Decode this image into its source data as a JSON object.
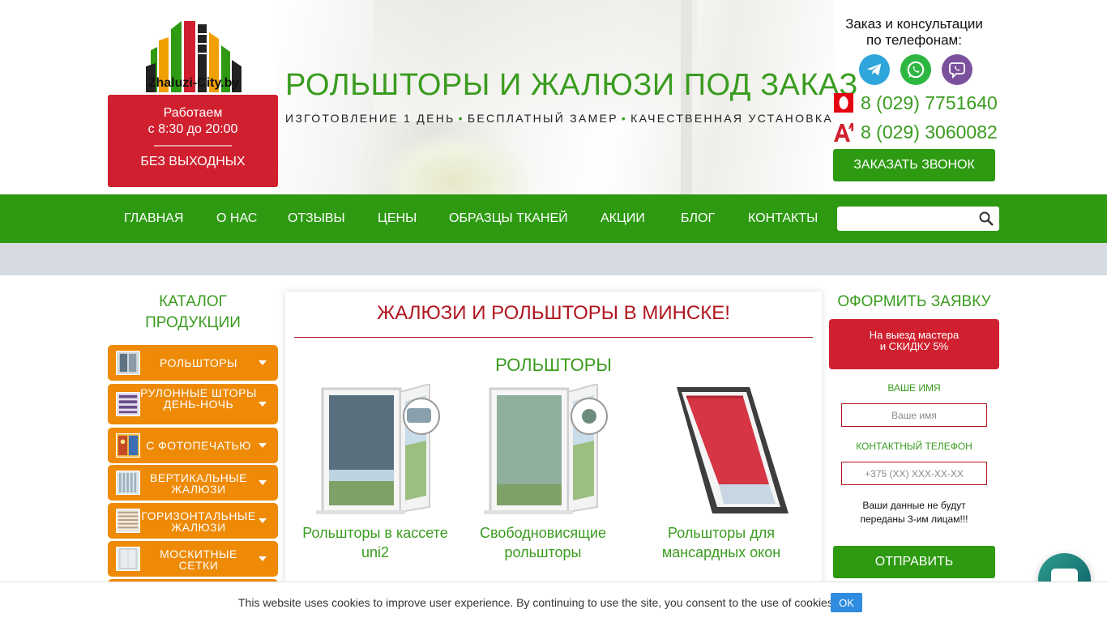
{
  "header": {
    "logo_text": "Zhaluzi-City.by",
    "hours": {
      "line1": "Работаем",
      "line2": "с 8:30 до 20:00",
      "divider": "——————",
      "line3": "БЕЗ ВЫХОДНЫХ"
    },
    "title": "РОЛЬШТОРЫ И ЖАЛЮЗИ ПОД ЗАКАЗ",
    "features": [
      "ИЗГОТОВЛЕНИЕ 1 ДЕНЬ",
      "БЕСПЛАТНЫЙ ЗАМЕР",
      "КАЧЕСТВЕННАЯ УСТАНОВКА"
    ],
    "feature_separator": "•",
    "contact_title_line1": "Заказ и консультации",
    "contact_title_line2": "по телефонам:",
    "messengers": [
      "telegram-icon",
      "whatsapp-icon",
      "viber-icon"
    ],
    "phones": [
      {
        "operator_icon": "mts-icon",
        "number": "8 (029) 7751640"
      },
      {
        "operator_icon": "a1-icon",
        "number": "8 (029) 3060082"
      }
    ],
    "call_button": "ЗАКАЗАТЬ ЗВОНОК"
  },
  "nav": {
    "items": [
      "ГЛАВНАЯ",
      "О НАС",
      "ОТЗЫВЫ",
      "ЦЕНЫ",
      "ОБРАЗЦЫ ТКАНЕЙ",
      "АКЦИИ",
      "БЛОГ",
      "КОНТАКТЫ"
    ],
    "search_placeholder": ""
  },
  "sidebar": {
    "title_line1": "КАТАЛОГ",
    "title_line2": "ПРОДУКЦИИ",
    "items": [
      {
        "label": "РОЛЬШТОРЫ"
      },
      {
        "label": "РУЛОННЫЕ ШТОРЫ ДЕНЬ-НОЧЬ"
      },
      {
        "label": "С ФОТОПЕЧАТЬЮ"
      },
      {
        "label": "ВЕРТИКАЛЬНЫЕ ЖАЛЮЗИ"
      },
      {
        "label": "ГОРИЗОНТАЛЬНЫЕ ЖАЛЮЗИ"
      },
      {
        "label": "МОСКИТНЫЕ СЕТКИ"
      }
    ]
  },
  "main": {
    "title": "ЖАЛЮЗИ И РОЛЬШТОРЫ В МИНСКЕ!",
    "section_title": "РОЛЬШТОРЫ",
    "products": [
      {
        "name_line1": "Рольшторы в кассете",
        "name_line2": "uni2"
      },
      {
        "name_line1": "Свободновисящие",
        "name_line2": "рольшторы"
      },
      {
        "name_line1": "Рольшторы для",
        "name_line2": "мансардных окон"
      }
    ]
  },
  "order_form": {
    "title": "ОФОРМИТЬ ЗАЯВКУ",
    "discount_line1": "На выезд мастера",
    "discount_line2": "и СКИДКУ 5%",
    "name_label": "ВАШЕ ИМЯ",
    "name_placeholder": "Ваше имя",
    "phone_label": "КОНТАКТНЫЙ ТЕЛЕФОН",
    "phone_placeholder": "+375 (XX) XXX-XX-XX",
    "privacy_line1": "Ваши данные не будут",
    "privacy_line2": "переданы 3-им лицам!!!",
    "submit": "ОТПРАВИТЬ"
  },
  "cookie": {
    "text": "This website uses cookies to improve user experience. By continuing to use the site, you consent to the use of cookies.",
    "ok": "OK"
  },
  "colors": {
    "brand_green": "#2e9a12",
    "text_green": "#3a9c1f",
    "brand_red": "#d0202f",
    "catalog_orange": "#ee8a06"
  }
}
